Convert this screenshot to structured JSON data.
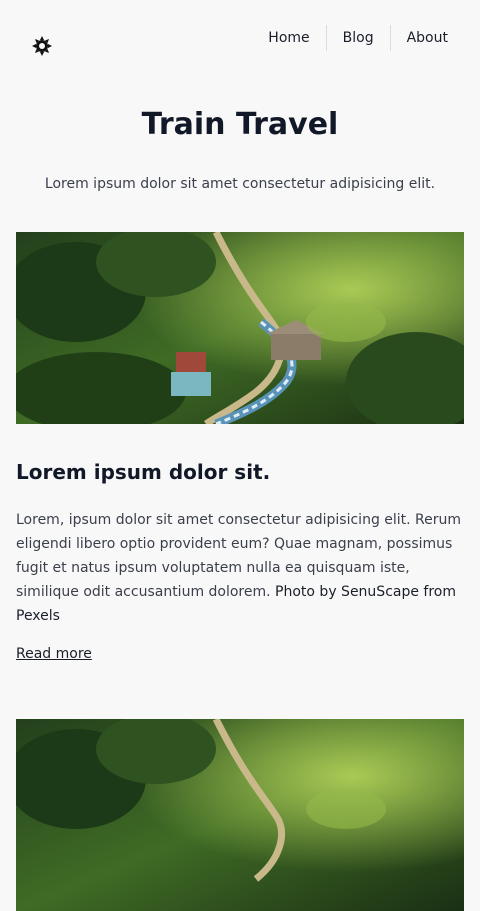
{
  "header": {
    "theme_toggle_icon": "sun-icon",
    "nav": [
      {
        "label": "Home"
      },
      {
        "label": "Blog"
      },
      {
        "label": "About"
      }
    ]
  },
  "hero": {
    "title": "Train Travel",
    "subtitle": "Lorem ipsum dolor sit amet consectetur adipisicing elit."
  },
  "posts": [
    {
      "title": "Lorem ipsum dolor sit.",
      "body": "Lorem, ipsum dolor sit amet consectetur adipisicing elit. Rerum eligendi libero optio provident eum? Quae magnam, possimus fugit et natus ipsum voluptatem nulla ea quisquam iste, similique odit accusantium dolorem.",
      "credit": "Photo by SenuScape from Pexels",
      "read_more": "Read more"
    }
  ],
  "colors": {
    "background": "#f8f8f8",
    "text": "#1b1f2a",
    "muted_text": "#3a3f4b"
  }
}
